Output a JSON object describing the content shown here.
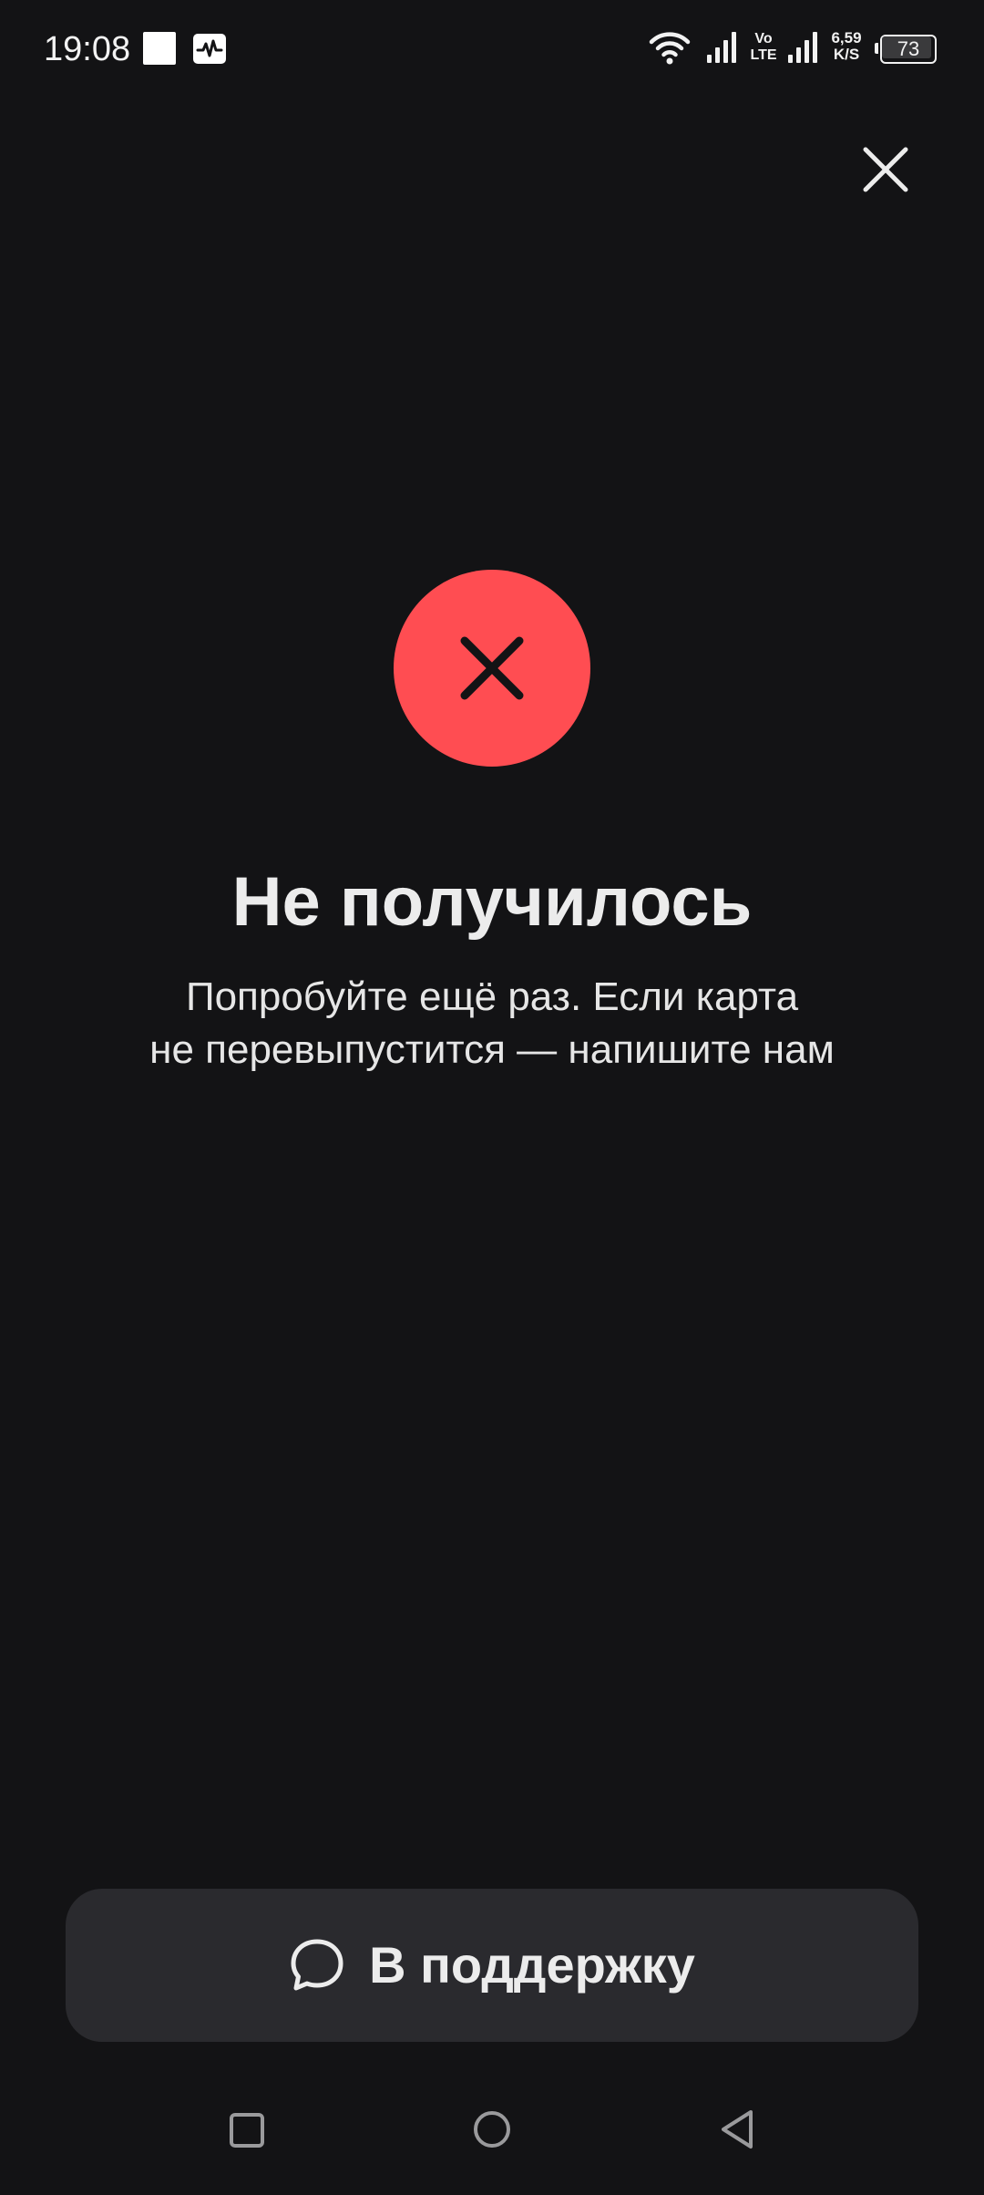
{
  "status_bar": {
    "time": "19:08",
    "network_type": "Vo\nLTE",
    "speed": "6,59\nK/S",
    "battery_level": "73",
    "icons": [
      "notification-square-icon",
      "activity-monitor-icon",
      "wifi-icon",
      "signal-icon",
      "signal-icon"
    ]
  },
  "header": {
    "close_icon": "close-icon"
  },
  "result": {
    "status_icon": "error-x-icon",
    "status_color": "#ff4d52",
    "title": "Не получилось",
    "message_line1": "Попробуйте ещё раз. Если карта",
    "message_line2": "не перевыпустится — напишите нам"
  },
  "support_button": {
    "icon": "chat-bubble-icon",
    "label": "В поддержку",
    "background": "#2a2a2e"
  },
  "navigation_bar": {
    "buttons": [
      "recents-icon",
      "home-icon",
      "back-icon"
    ]
  },
  "colors": {
    "background": "#131315",
    "text_primary": "#ececec",
    "accent_error": "#ff4d52"
  }
}
